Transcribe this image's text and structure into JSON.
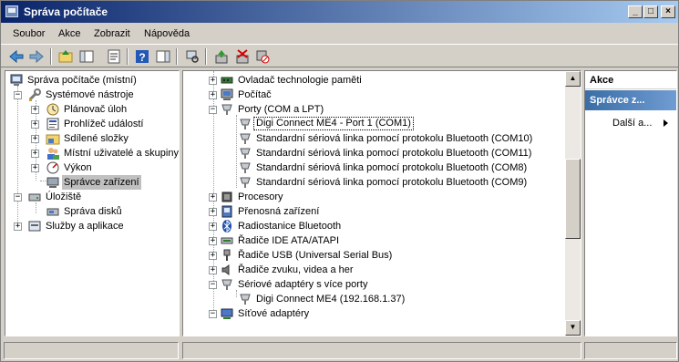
{
  "window": {
    "title": "Správa počítače"
  },
  "titlebar_buttons": {
    "minimize": "_",
    "maximize": "□",
    "close": "×"
  },
  "menu": [
    {
      "label": "Soubor",
      "accel": "S"
    },
    {
      "label": "Akce",
      "accel": "A"
    },
    {
      "label": "Zobrazit",
      "accel": "Z"
    },
    {
      "label": "Nápověda",
      "accel": "N"
    }
  ],
  "toolbar": {
    "icons": [
      "back-arrow-icon",
      "forward-arrow-icon",
      "up-folder-icon",
      "show-hide-console-tree-icon",
      "properties-icon",
      "help-icon",
      "show-action-pane-icon",
      "scan-hardware-changes-icon",
      "update-driver-icon",
      "uninstall-icon",
      "disable-device-icon"
    ]
  },
  "left_tree": [
    {
      "label": "Správa počítače (místní)",
      "icon": "computer-management-icon"
    },
    {
      "label": "Systémové nástroje",
      "icon": "system-tools-icon"
    },
    {
      "label": "Plánovač úloh",
      "icon": "task-scheduler-icon"
    },
    {
      "label": "Prohlížeč událostí",
      "icon": "event-viewer-icon"
    },
    {
      "label": "Sdílené složky",
      "icon": "shared-folders-icon"
    },
    {
      "label": "Místní uživatelé a skupiny",
      "icon": "users-groups-icon"
    },
    {
      "label": "Výkon",
      "icon": "performance-icon"
    },
    {
      "label": "Správce zařízení",
      "icon": "device-manager-icon"
    },
    {
      "label": "Úložiště",
      "icon": "storage-icon"
    },
    {
      "label": "Správa disků",
      "icon": "disk-management-icon"
    },
    {
      "label": "Služby a aplikace",
      "icon": "services-apps-icon"
    }
  ],
  "device_tree": [
    {
      "label": "Ovladač technologie paměti",
      "icon": "memory-icon"
    },
    {
      "label": "Počítač",
      "icon": "computer-icon"
    },
    {
      "label": "Porty (COM a LPT)",
      "icon": "port-icon"
    },
    {
      "label": "Digi Connect ME4 - Port 1 (COM1)",
      "icon": "port-icon"
    },
    {
      "label": "Standardní sériová linka pomocí protokolu Bluetooth (COM10)",
      "icon": "port-icon"
    },
    {
      "label": "Standardní sériová linka pomocí protokolu Bluetooth (COM11)",
      "icon": "port-icon"
    },
    {
      "label": "Standardní sériová linka pomocí protokolu Bluetooth (COM8)",
      "icon": "port-icon"
    },
    {
      "label": "Standardní sériová linka pomocí protokolu Bluetooth (COM9)",
      "icon": "port-icon"
    },
    {
      "label": "Procesory",
      "icon": "processor-icon"
    },
    {
      "label": "Přenosná zařízení",
      "icon": "portable-device-icon"
    },
    {
      "label": "Radiostanice Bluetooth",
      "icon": "bluetooth-icon"
    },
    {
      "label": "Řadiče IDE ATA/ATAPI",
      "icon": "ide-controller-icon"
    },
    {
      "label": "Řadiče USB (Universal Serial Bus)",
      "icon": "usb-icon"
    },
    {
      "label": "Řadiče zvuku, videa a her",
      "icon": "sound-icon"
    },
    {
      "label": "Sériové adaptéry s více porty",
      "icon": "port-icon"
    },
    {
      "label": "Digi Connect ME4 (192.168.1.37)",
      "icon": "port-icon"
    },
    {
      "label": "Síťové adaptéry",
      "icon": "network-adapter-icon"
    }
  ],
  "actions": {
    "header": "Akce",
    "section": "Správce z...",
    "more": "Další a..."
  },
  "colors": {
    "title_start": "#0a246a",
    "title_end": "#a6caf0",
    "selection": "#c0c0c0",
    "action_header": "#3a6ea5"
  }
}
